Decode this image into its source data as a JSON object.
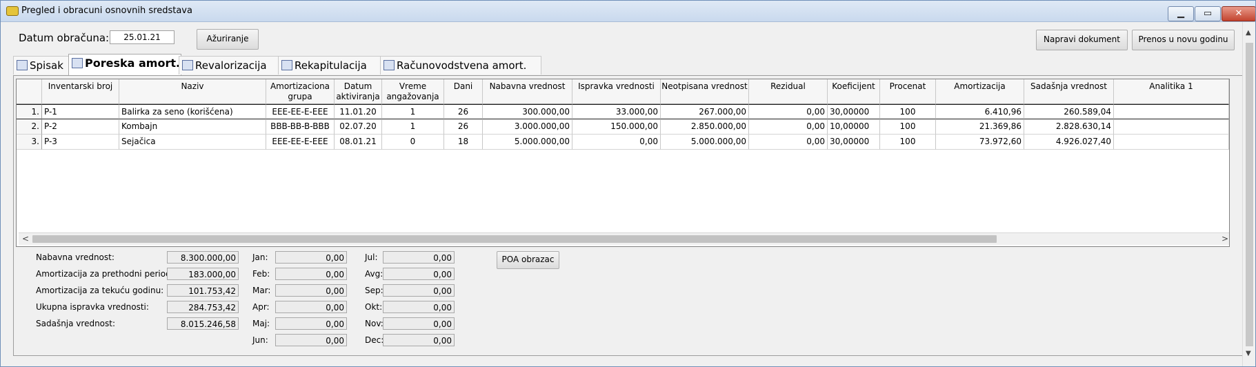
{
  "window": {
    "title": "Pregled i obracuni osnovnih sredstava",
    "minimize": "▁",
    "restore": "▭",
    "close": "✕"
  },
  "header": {
    "date_label": "Datum obračuna:",
    "date_value": "25.01.21",
    "refresh_label": "Ažuriranje",
    "make_doc_label": "Napravi dokument",
    "transfer_label": "Prenos u novu godinu"
  },
  "tabs": [
    {
      "label": "Spisak"
    },
    {
      "label": "Poreska amort."
    },
    {
      "label": "Revalorizacija"
    },
    {
      "label": "Rekapitulacija"
    },
    {
      "label": "Računovodstvena amort."
    }
  ],
  "table": {
    "columns": [
      "",
      "Inventarski broj",
      "Naziv",
      "Amortizaciona grupa",
      "Datum aktiviranja",
      "Vreme angažovanja",
      "Dani",
      "Nabavna vrednost",
      "Ispravka vrednosti",
      "Neotpisana vrednost",
      "Rezidual",
      "Koeficijent",
      "Procenat",
      "Amortizacija",
      "Sadašnja vrednost",
      "Analitika 1"
    ],
    "rows": [
      [
        "1.",
        "P-1",
        "Balirka za seno (korišćena)",
        "EEE-EE-E-EEE",
        "11.01.20",
        "1",
        "26",
        "300.000,00",
        "33.000,00",
        "267.000,00",
        "0,00",
        "30,00000",
        "100",
        "6.410,96",
        "260.589,04",
        ""
      ],
      [
        "2.",
        "P-2",
        "Kombajn",
        "BBB-BB-B-BBB",
        "02.07.20",
        "1",
        "26",
        "3.000.000,00",
        "150.000,00",
        "2.850.000,00",
        "0,00",
        "10,00000",
        "100",
        "21.369,86",
        "2.828.630,14",
        ""
      ],
      [
        "3.",
        "P-3",
        "Sejačica",
        "EEE-EE-E-EEE",
        "08.01.21",
        "0",
        "18",
        "5.000.000,00",
        "0,00",
        "5.000.000,00",
        "0,00",
        "30,00000",
        "100",
        "73.972,60",
        "4.926.027,40",
        ""
      ]
    ]
  },
  "summary": [
    {
      "label": "Nabavna vrednost:",
      "value": "8.300.000,00"
    },
    {
      "label": "Amortizacija za prethodni period:",
      "value": "183.000,00"
    },
    {
      "label": "Amortizacija za tekuću godinu:",
      "value": "101.753,42"
    },
    {
      "label": "Ukupna ispravka vrednosti:",
      "value": "284.753,42"
    },
    {
      "label": "Sadašnja vrednost:",
      "value": "8.015.246,58"
    }
  ],
  "months_left": [
    {
      "label": "Jan:",
      "value": "0,00"
    },
    {
      "label": "Feb:",
      "value": "0,00"
    },
    {
      "label": "Mar:",
      "value": "0,00"
    },
    {
      "label": "Apr:",
      "value": "0,00"
    },
    {
      "label": "Maj:",
      "value": "0,00"
    },
    {
      "label": "Jun:",
      "value": "0,00"
    }
  ],
  "months_right": [
    {
      "label": "Jul:",
      "value": "0,00"
    },
    {
      "label": "Avg:",
      "value": "0,00"
    },
    {
      "label": "Sep:",
      "value": "0,00"
    },
    {
      "label": "Okt:",
      "value": "0,00"
    },
    {
      "label": "Nov:",
      "value": "0,00"
    },
    {
      "label": "Dec:",
      "value": "0,00"
    }
  ],
  "poa_label": "POA obrazac",
  "scroll": {
    "left_arrow": "<",
    "right_arrow": ">",
    "up_arrow": "▲",
    "down_arrow": "▼"
  }
}
